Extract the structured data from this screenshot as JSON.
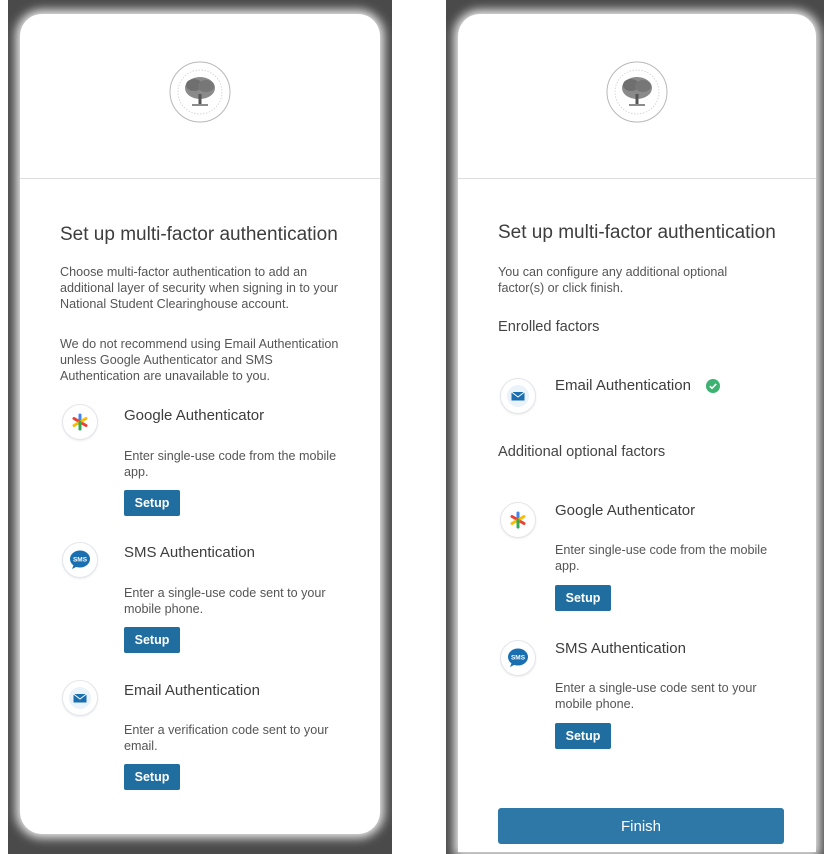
{
  "left": {
    "title": "Set up multi-factor authentication",
    "intro": "Choose multi-factor authentication to add an additional layer of security when signing in to your National Student Clearinghouse account.",
    "note": "We do not recommend using Email Authentication unless Google Authenticator and SMS Authentication are unavailable to you.",
    "factors": [
      {
        "name": "Google Authenticator",
        "description": "Enter single-use code from the mobile app.",
        "button": "Setup",
        "icon": "google-authenticator-icon"
      },
      {
        "name": "SMS Authentication",
        "description": "Enter a single-use code sent to your mobile phone.",
        "button": "Setup",
        "icon": "sms-icon"
      },
      {
        "name": "Email Authentication",
        "description": "Enter a verification code sent to your email.",
        "button": "Setup",
        "icon": "email-icon"
      }
    ]
  },
  "right": {
    "title": "Set up multi-factor authentication",
    "intro": "You can configure any additional optional factor(s) or click finish.",
    "enrolled_title": "Enrolled factors",
    "enrolled": [
      {
        "name": "Email Authentication",
        "icon": "email-icon",
        "status_icon": "check-circle-icon"
      }
    ],
    "optional_title": "Additional optional factors",
    "optional": [
      {
        "name": "Google Authenticator",
        "description": "Enter single-use code from the mobile app.",
        "button": "Setup",
        "icon": "google-authenticator-icon"
      },
      {
        "name": "SMS Authentication",
        "description": "Enter a single-use code sent to your mobile phone.",
        "button": "Setup",
        "icon": "sms-icon"
      }
    ],
    "finish": "Finish"
  },
  "colors": {
    "button_bg": "#1f6e9f",
    "finish_bg": "#2e78a8",
    "check_green": "#3cb371",
    "frame_dark": "#4a4a4a"
  }
}
